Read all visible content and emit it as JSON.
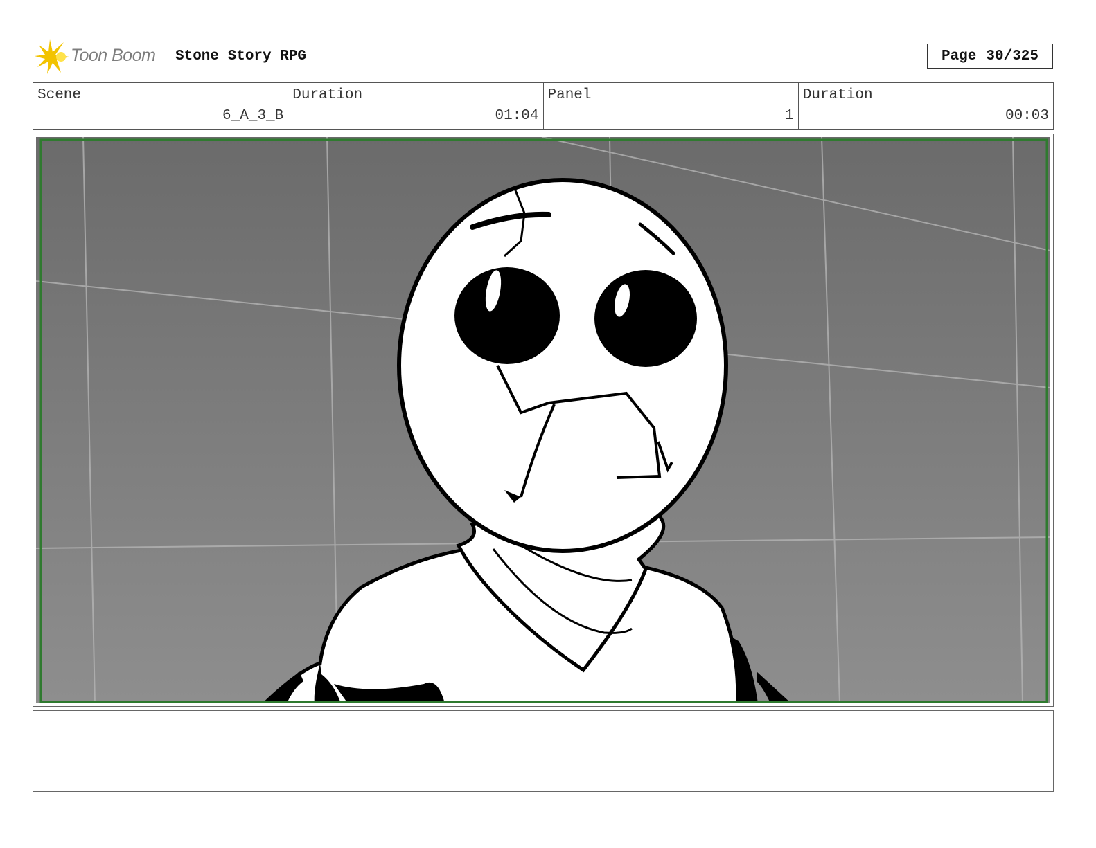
{
  "header": {
    "logo_text": "Toon Boom",
    "project_title": "Stone Story RPG",
    "page_label": "Page",
    "page_value": "30/325"
  },
  "info": {
    "scene_label": "Scene",
    "scene_value": "6_A_3_B",
    "scene_duration_label": "Duration",
    "scene_duration_value": "01:04",
    "panel_label": "Panel",
    "panel_value": "1",
    "panel_duration_label": "Duration",
    "panel_duration_value": "00:03"
  },
  "panel": {
    "safe_frame_color": "#2f7a2f"
  },
  "notes": {
    "text": ""
  },
  "colors": {
    "logo_accent": "#f2c300",
    "logo_text": "#7d7d7d"
  }
}
